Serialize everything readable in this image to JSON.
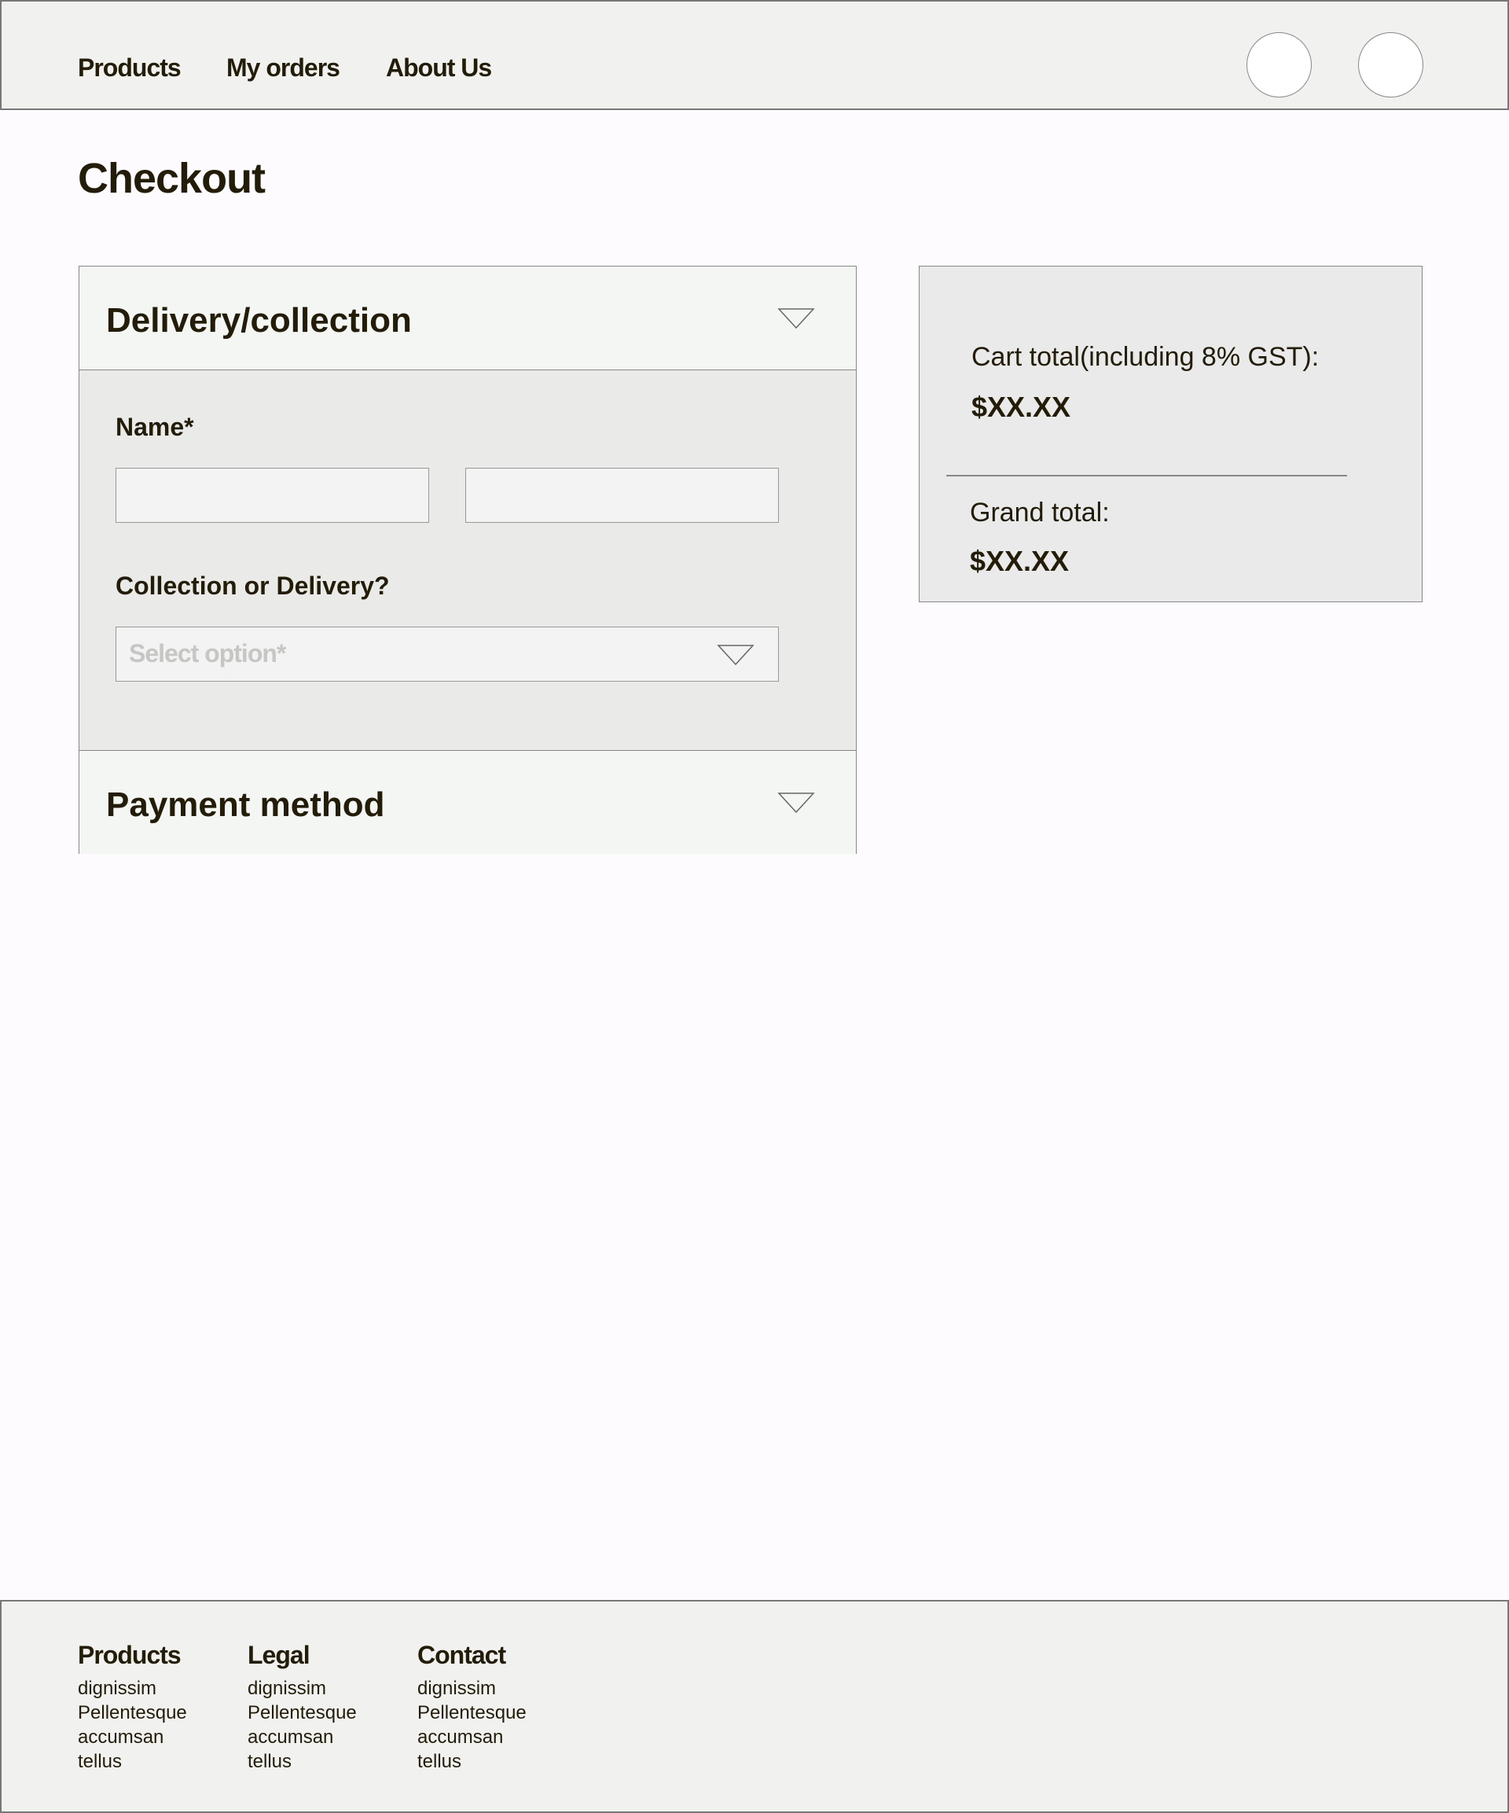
{
  "nav": {
    "items": [
      "Products",
      "My orders",
      "About Us"
    ]
  },
  "page": {
    "title": "Checkout"
  },
  "accordion": {
    "delivery": {
      "title": "Delivery/collection",
      "name_label": "Name*",
      "method_label": "Collection or Delivery?",
      "select_placeholder": "Select option*"
    },
    "payment": {
      "title": "Payment method"
    }
  },
  "summary": {
    "cart_label": "Cart total(including 8% GST):",
    "cart_value": "$XX.XX",
    "grand_label": "Grand total:",
    "grand_value": "$XX.XX"
  },
  "footer": {
    "columns": [
      {
        "title": "Products",
        "items": [
          "dignissim",
          "Pellentesque",
          "accumsan",
          "tellus"
        ]
      },
      {
        "title": "Legal",
        "items": [
          "dignissim",
          "Pellentesque",
          "accumsan",
          "tellus"
        ]
      },
      {
        "title": "Contact",
        "items": [
          "dignissim",
          "Pellentesque",
          "accumsan",
          "tellus"
        ]
      }
    ]
  }
}
